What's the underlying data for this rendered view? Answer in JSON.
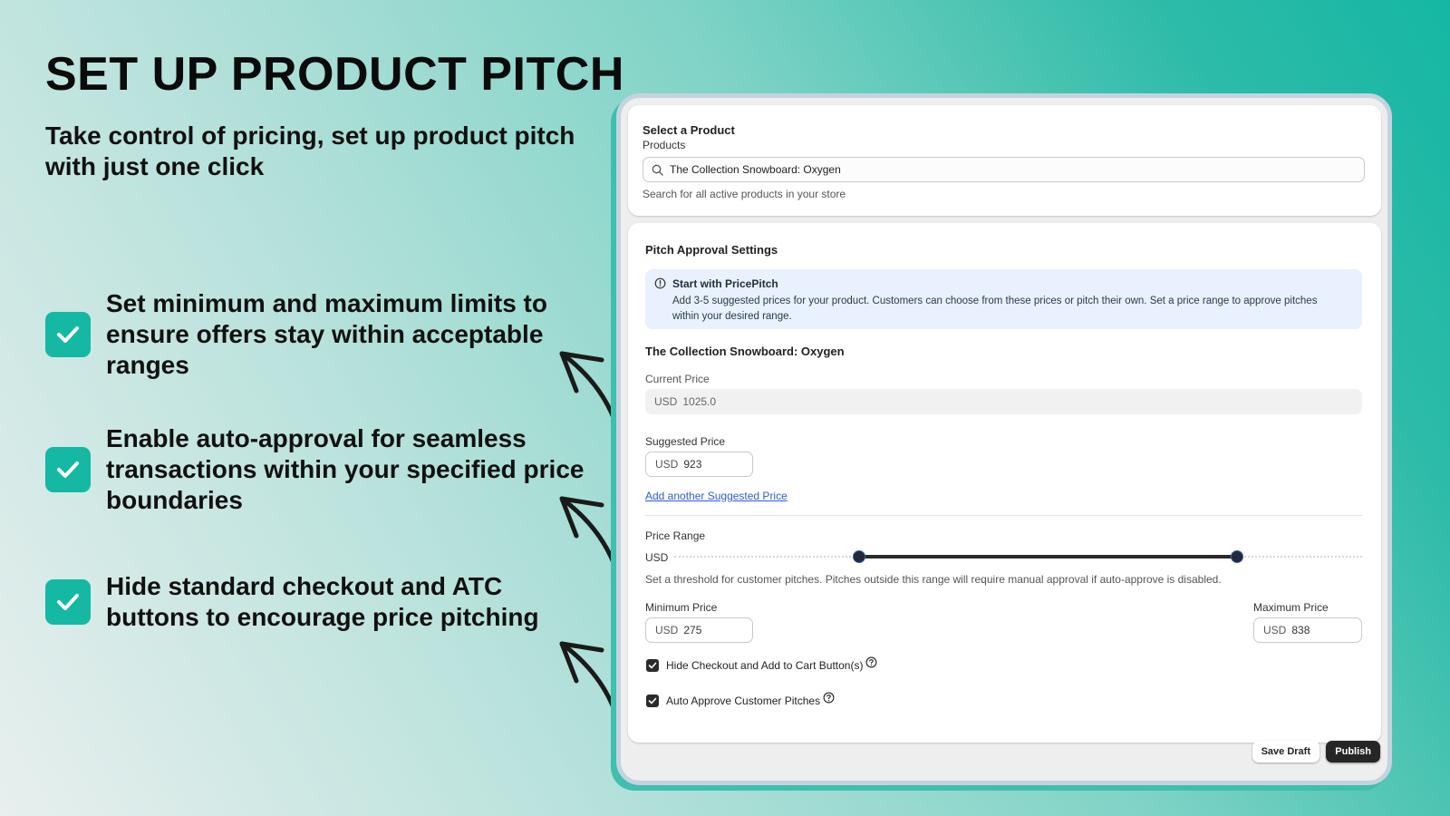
{
  "hero": {
    "title": "SET UP PRODUCT PITCH",
    "subtitle": "Take control of pricing, set up product pitch with just one click"
  },
  "features": [
    {
      "text": "Set minimum and maximum limits to ensure offers stay within acceptable ranges",
      "icon": "check-icon"
    },
    {
      "text": "Enable auto-approval for seamless transactions within your specified price boundaries",
      "icon": "check-icon"
    },
    {
      "text": "Hide standard checkout and ATC buttons to encourage price pitching",
      "icon": "check-icon"
    }
  ],
  "colors": {
    "accent": "#14b8a3",
    "link": "#2c5bd6",
    "banner_bg": "#e8f1fd",
    "primary_button": "#262626"
  },
  "app": {
    "select_product": {
      "title": "Select a Product",
      "field_label": "Products",
      "search_value": "The Collection Snowboard: Oxygen",
      "help_text": "Search for all active products in your store",
      "icon": "search-icon"
    },
    "pitch_settings": {
      "title": "Pitch Approval Settings",
      "banner": {
        "icon": "info-icon",
        "title": "Start with PricePitch",
        "body": "Add 3-5 suggested prices for your product. Customers can choose from these prices or pitch their own. Set a price range to approve pitches within your desired range."
      },
      "product_name": "The Collection Snowboard: Oxygen",
      "current_price": {
        "label": "Current Price",
        "currency": "USD",
        "value": "1025.0"
      },
      "suggested_price": {
        "label": "Suggested Price",
        "currency": "USD",
        "value": "923"
      },
      "add_suggested_link": "Add another Suggested Price",
      "price_range": {
        "label": "Price Range",
        "currency": "USD",
        "slider_min": 0,
        "slider_max": 1025,
        "low": 275,
        "high": 838,
        "help_text": "Set a threshold for customer pitches. Pitches outside this range will require manual approval if auto-approve is disabled."
      },
      "minimum_price": {
        "label": "Minimum Price",
        "currency": "USD",
        "value": "275"
      },
      "maximum_price": {
        "label": "Maximum Price",
        "currency": "USD",
        "value": "838"
      },
      "checkboxes": [
        {
          "label": "Hide Checkout and Add to Cart Button(s)",
          "checked": true,
          "help_icon": "question-circle-icon"
        },
        {
          "label": "Auto Approve Customer Pitches",
          "checked": true,
          "help_icon": "question-circle-icon"
        }
      ]
    },
    "footer": {
      "save_label": "Save Draft",
      "publish_label": "Publish"
    }
  }
}
